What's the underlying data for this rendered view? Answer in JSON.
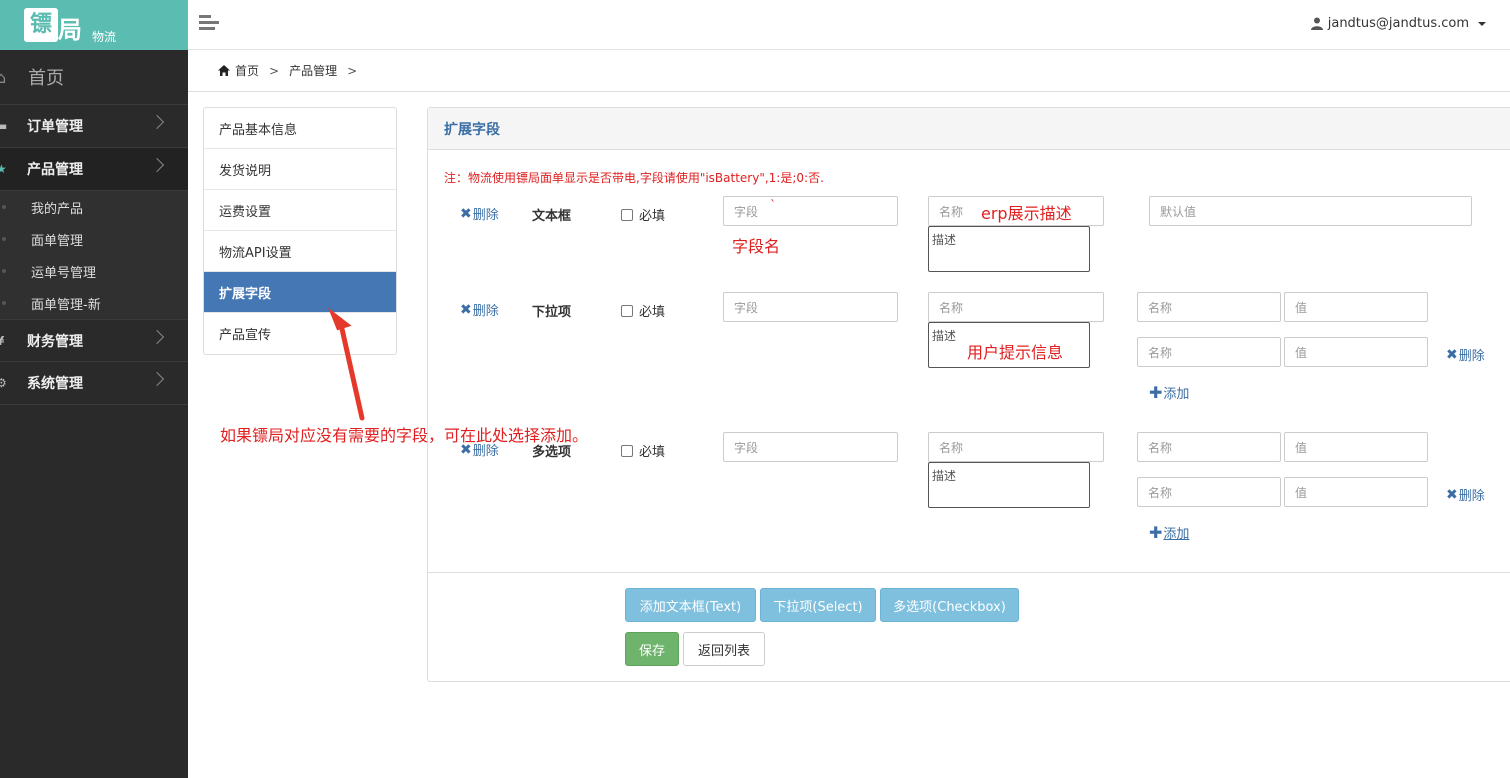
{
  "logo": {
    "char1": "镖",
    "char2": "局",
    "sub": "物流"
  },
  "sidebar": {
    "home": "首页",
    "items": [
      {
        "label": "订单管理"
      },
      {
        "label": "产品管理"
      },
      {
        "label": "财务管理"
      },
      {
        "label": "系统管理"
      }
    ],
    "sub_items": [
      "我的产品",
      "面单管理",
      "运单号管理",
      "面单管理-新"
    ]
  },
  "header": {
    "user": "jandtus@jandtus.com"
  },
  "breadcrumb": {
    "home": "首页",
    "current": "产品管理",
    "sep": ">"
  },
  "tabs": [
    "产品基本信息",
    "发货说明",
    "运费设置",
    "物流API设置",
    "扩展字段",
    "产品宣传"
  ],
  "panel": {
    "title": "扩展字段",
    "note": "注：物流使用镖局面单显示是否带电,字段请使用\"isBattery\",1:是;0:否.",
    "delete_label": "删除",
    "add_label": "添加",
    "required_label": "必填",
    "rows": [
      {
        "type": "文本框",
        "field_ph": "字段",
        "name_ph": "名称",
        "desc_ph": "描述",
        "default_ph": "默认值"
      },
      {
        "type": "下拉项",
        "field_ph": "字段",
        "name_ph": "名称",
        "desc_ph": "描述",
        "opt_name_ph": "名称",
        "opt_value_ph": "值"
      },
      {
        "type": "多选项",
        "field_ph": "字段",
        "name_ph": "名称",
        "desc_ph": "描述",
        "opt_name_ph": "名称",
        "opt_value_ph": "值"
      }
    ]
  },
  "buttons": {
    "add_text": "添加文本框(Text)",
    "add_select": "下拉项(Select)",
    "add_checkbox": "多选项(Checkbox)",
    "save": "保存",
    "back": "返回列表"
  },
  "annotations": {
    "erp": "erp展示描述",
    "field_name": "字段名",
    "user_hint": "用户提示信息",
    "arrow_note": "如果镖局对应没有需要的字段，可在此处选择添加。",
    "tick": "`"
  },
  "colors": {
    "accent": "#4677b5",
    "logo_bg": "#5bbcb1",
    "annotation": "#e02020",
    "sidebar_bg": "#2a2a2a"
  }
}
